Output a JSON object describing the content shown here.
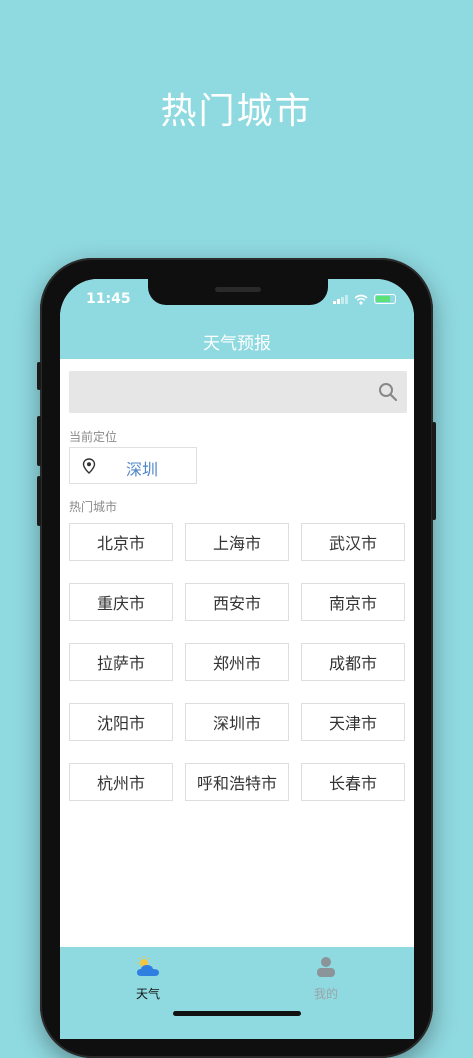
{
  "hero": {
    "title": "热门城市"
  },
  "status_bar": {
    "time": "11:45"
  },
  "app": {
    "title": "天气预报"
  },
  "search": {
    "placeholder": "",
    "icon": "search-icon"
  },
  "current_location": {
    "label": "当前定位",
    "city": "深圳",
    "icon": "pin-icon"
  },
  "hot_cities": {
    "label": "热门城市",
    "items": [
      "北京市",
      "上海市",
      "武汉市",
      "重庆市",
      "西安市",
      "南京市",
      "拉萨市",
      "郑州市",
      "成都市",
      "沈阳市",
      "深圳市",
      "天津市",
      "杭州市",
      "呼和浩特市",
      "长春市"
    ]
  },
  "tabs": [
    {
      "label": "天气",
      "icon": "weather-cloud-icon",
      "active": true
    },
    {
      "label": "我的",
      "icon": "person-icon",
      "active": false
    }
  ],
  "colors": {
    "accent": "#8fd9e0",
    "active_tab": "#111111",
    "inactive_tab": "#9aa4a8",
    "location_text": "#4f86c6"
  }
}
